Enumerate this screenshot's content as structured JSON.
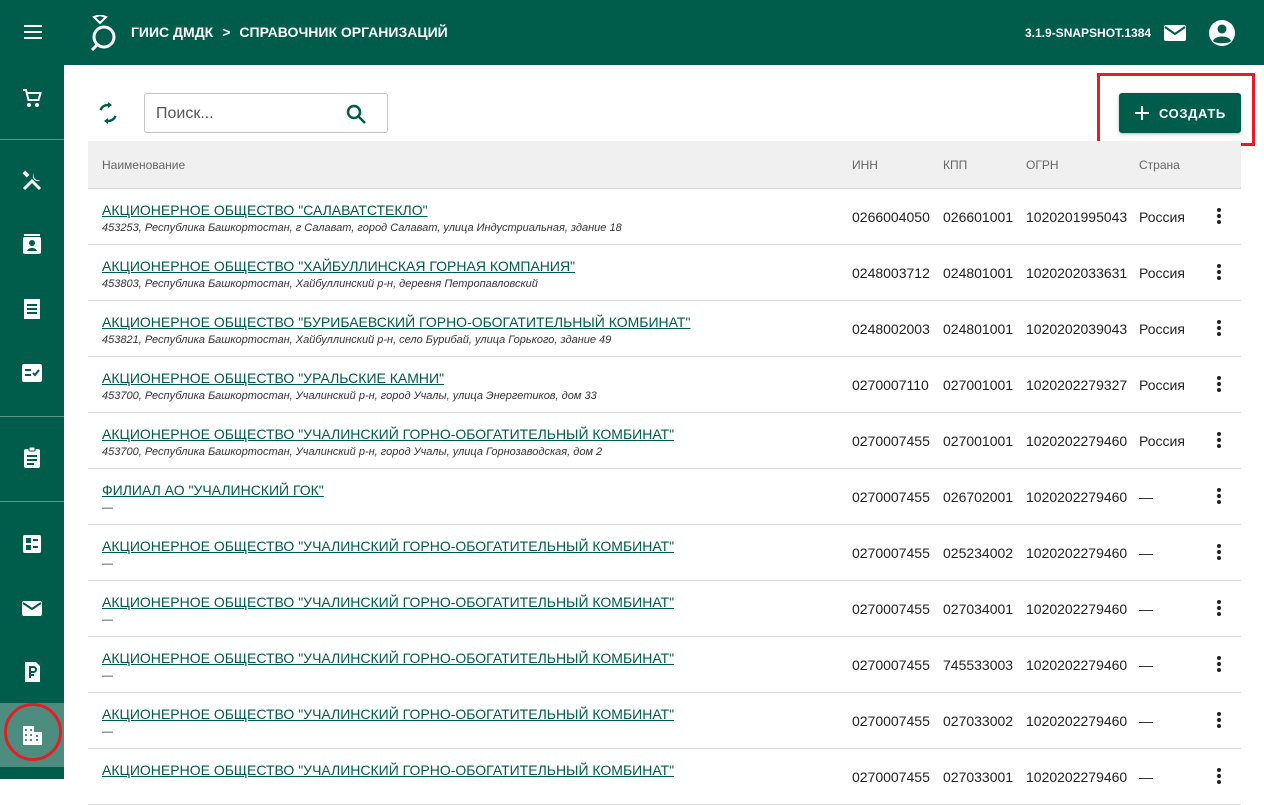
{
  "header": {
    "app_name": "ГИИС ДМДК",
    "separator": ">",
    "page_title": "СПРАВОЧНИК ОРГАНИЗАЦИЙ",
    "version": "3.1.9-SNAPSHOT.1384"
  },
  "toolbar": {
    "search_placeholder": "Поиск...",
    "create_label": "СОЗДАТЬ"
  },
  "table": {
    "columns": [
      "Наименование",
      "ИНН",
      "КПП",
      "ОГРН",
      "Страна"
    ],
    "rows": [
      {
        "name": "АКЦИОНЕРНОЕ ОБЩЕСТВО \"САЛАВАТСТЕКЛО\"",
        "address": "453253, Республика Башкортостан, г Салават, город Салават, улица Индустриальная, здание 18",
        "inn": "0266004050",
        "kpp": "026601001",
        "ogrn": "1020201995043",
        "country": "Россия"
      },
      {
        "name": "АКЦИОНЕРНОЕ ОБЩЕСТВО \"ХАЙБУЛЛИНСКАЯ ГОРНАЯ КОМПАНИЯ\"",
        "address": "453803, Республика Башкортостан, Хайбуллинский р-н, деревня Петропавловский",
        "inn": "0248003712",
        "kpp": "024801001",
        "ogrn": "1020202033631",
        "country": "Россия"
      },
      {
        "name": "АКЦИОНЕРНОЕ ОБЩЕСТВО \"БУРИБАЕВСКИЙ ГОРНО-ОБОГАТИТЕЛЬНЫЙ КОМБИНАТ\"",
        "address": "453821, Республика Башкортостан, Хайбуллинский р-н, село Бурибай, улица Горького, здание 49",
        "inn": "0248002003",
        "kpp": "024801001",
        "ogrn": "1020202039043",
        "country": "Россия"
      },
      {
        "name": "АКЦИОНЕРНОЕ ОБЩЕСТВО \"УРАЛЬСКИЕ КАМНИ\"",
        "address": "453700, Республика Башкортостан, Учалинский р-н, город Учалы, улица Энергетиков, дом 33",
        "inn": "0270007110",
        "kpp": "027001001",
        "ogrn": "1020202279327",
        "country": "Россия"
      },
      {
        "name": "АКЦИОНЕРНОЕ ОБЩЕСТВО \"УЧАЛИНСКИЙ ГОРНО-ОБОГАТИТЕЛЬНЫЙ КОМБИНАТ\"",
        "address": "453700, Республика Башкортостан, Учалинский р-н, город Учалы, улица Горнозаводская, дом 2",
        "inn": "0270007455",
        "kpp": "027001001",
        "ogrn": "1020202279460",
        "country": "Россия"
      },
      {
        "name": "ФИЛИАЛ АО \"УЧАЛИНСКИЙ ГОК\"",
        "address": "—",
        "inn": "0270007455",
        "kpp": "026702001",
        "ogrn": "1020202279460",
        "country": "—"
      },
      {
        "name": "АКЦИОНЕРНОЕ ОБЩЕСТВО \"УЧАЛИНСКИЙ ГОРНО-ОБОГАТИТЕЛЬНЫЙ КОМБИНАТ\"",
        "address": "—",
        "inn": "0270007455",
        "kpp": "025234002",
        "ogrn": "1020202279460",
        "country": "—"
      },
      {
        "name": "АКЦИОНЕРНОЕ ОБЩЕСТВО \"УЧАЛИНСКИЙ ГОРНО-ОБОГАТИТЕЛЬНЫЙ КОМБИНАТ\"",
        "address": "—",
        "inn": "0270007455",
        "kpp": "027034001",
        "ogrn": "1020202279460",
        "country": "—"
      },
      {
        "name": "АКЦИОНЕРНОЕ ОБЩЕСТВО \"УЧАЛИНСКИЙ ГОРНО-ОБОГАТИТЕЛЬНЫЙ КОМБИНАТ\"",
        "address": "—",
        "inn": "0270007455",
        "kpp": "745533003",
        "ogrn": "1020202279460",
        "country": "—"
      },
      {
        "name": "АКЦИОНЕРНОЕ ОБЩЕСТВО \"УЧАЛИНСКИЙ ГОРНО-ОБОГАТИТЕЛЬНЫЙ КОМБИНАТ\"",
        "address": "—",
        "inn": "0270007455",
        "kpp": "027033002",
        "ogrn": "1020202279460",
        "country": "—"
      },
      {
        "name": "АКЦИОНЕРНОЕ ОБЩЕСТВО \"УЧАЛИНСКИЙ ГОРНО-ОБОГАТИТЕЛЬНЫЙ КОМБИНАТ\"",
        "address": "",
        "inn": "0270007455",
        "kpp": "027033001",
        "ogrn": "1020202279460",
        "country": "—"
      }
    ]
  },
  "sidebar": {
    "icons": [
      "menu-icon",
      "cart-icon",
      "tools-icon",
      "contact-card-icon",
      "receipt-icon",
      "checklist-icon",
      "clipboard-icon",
      "dashboard-icon",
      "mail-icon",
      "ruble-icon",
      "building-icon"
    ],
    "active": "building-icon"
  },
  "colors": {
    "primary": "#005c4b",
    "active_sidebar": "#4d8d80",
    "highlight": "#e41e26",
    "link": "#005c4b"
  }
}
